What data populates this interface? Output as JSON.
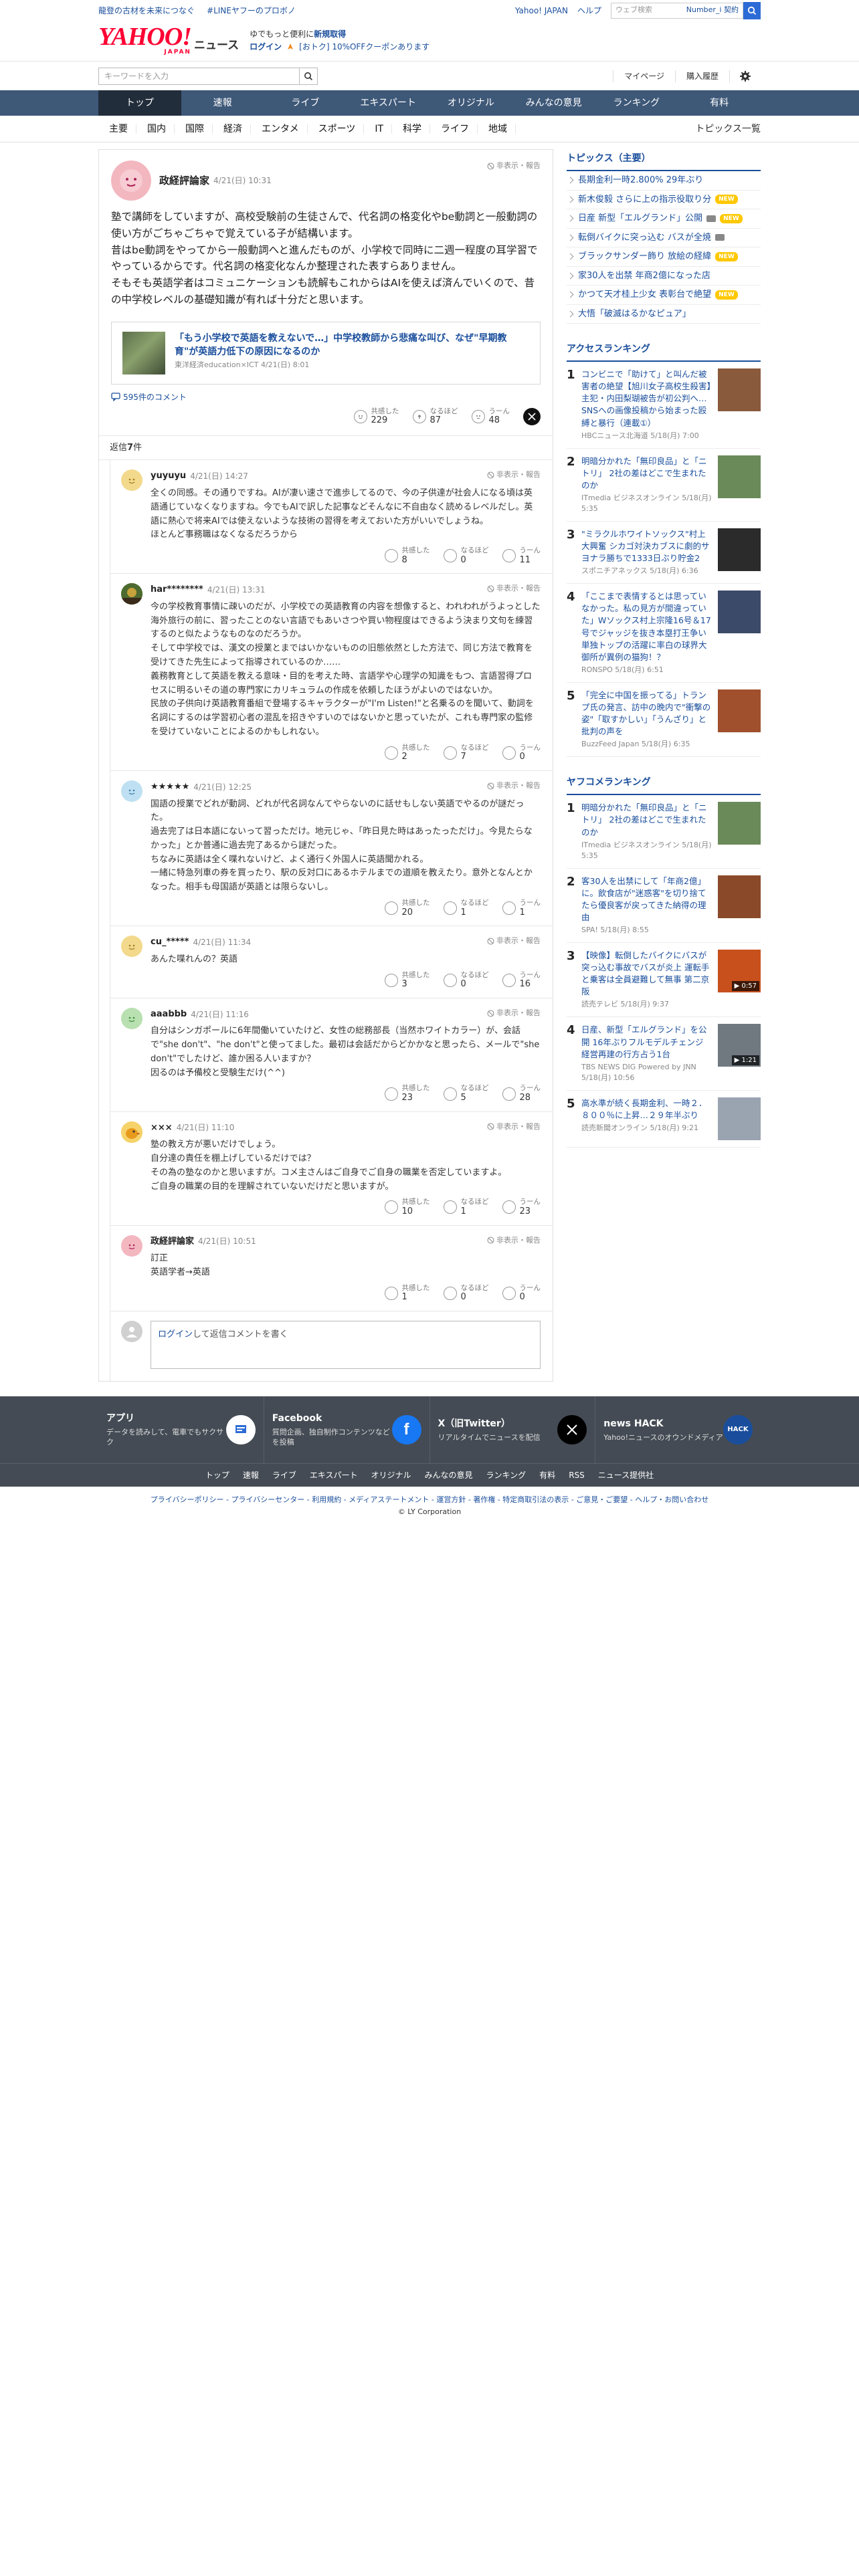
{
  "topstrip": {
    "link1": "龍登の古材を未来につなぐ",
    "link2": "#LINEヤフーのプロボノ",
    "yahoo": "Yahoo! JAPAN",
    "help": "ヘルプ",
    "web_placeholder": "ウェブ検索",
    "scope": "Number_i 契約"
  },
  "masthead": {
    "logo": "YAHOO!",
    "logo_sub": "JAPAN",
    "service": "ニュース",
    "promo_line1_a": "ゆでもっと便利に",
    "promo_line1_b": "新規取得",
    "login": "ログイン",
    "promo_line2": "[おトク] 10%OFFクーポンあります"
  },
  "searchbar": {
    "placeholder": "キーワードを入力",
    "mypage": "マイページ",
    "history": "購入履歴"
  },
  "mainnav": [
    "トップ",
    "速報",
    "ライブ",
    "エキスパート",
    "オリジナル",
    "みんなの意見",
    "ランキング",
    "有料"
  ],
  "subnav": [
    "主要",
    "国内",
    "国際",
    "経済",
    "エンタメ",
    "スポーツ",
    "IT",
    "科学",
    "ライフ",
    "地域"
  ],
  "subnav_more": "トピックス一覧",
  "original": {
    "user": "政経評論家",
    "time": "4/21(日) 10:31",
    "report": "非表示・報告",
    "text": "塾で講師をしていますが、高校受験前の生徒さんで、代名詞の格変化やbe動詞と一般動詞の使い方がごちゃごちゃで覚えている子が結構います。\n昔はbe動詞をやってから一般動詞へと進んだものが、小学校で同時に二週一程度の耳学習でやっているからです。代名詞の格変化なんか整理された表すらありません。\nそもそも英語学者はコミュニケーションも読解もこれからはAIを使えば済んでいくので、昔の中学校レベルの基礎知識が有れば十分だと思います。",
    "article_title": "「もう小学校で英語を教えないで…」中学校教師から悲痛な叫び、なぜ\"早期教育\"が英語力低下の原因になるのか",
    "article_source": "東洋経済education×ICT 4/21(日) 8:01",
    "comment_count": "595件のコメント",
    "labels": {
      "agree": "共感した",
      "hmm": "なるほど",
      "umm": "うーん"
    },
    "agree": "229",
    "hmm": "87",
    "umm": "48"
  },
  "reply_count_prefix": "返信",
  "reply_count": "7",
  "reply_count_suffix": "件",
  "replies": [
    {
      "user": "yuyuyu",
      "time": "4/21(日) 14:27",
      "report": "非表示・報告",
      "text": "全くの同感。その通りですね。AIが凄い速さで進歩してるので、今の子供達が社会人になる頃は英語通じていなくなりますね。今でもAIで訳した記事などそんなに不自由なく読めるレベルだし。英語に熱心で将来AIでは使えないような技術の習得を考えておいた方がいいでしょうね。\nほとんど事務職はなくなるだろうから",
      "agree": "8",
      "hmm": "0",
      "umm": "11"
    },
    {
      "user": "har********",
      "time": "4/21(日) 13:31",
      "report": "非表示・報告",
      "text": "今の学校教育事情に疎いのだが、小学校での英語教育の内容を想像すると、われわれがうよっとした海外旅行の前に、習ったことのない言語でもあいさつや買い物程度はできるよう決まり文句を練習するのと似たようなものなのだろうか。\nそして中学校では、漢文の授業とまではいかないものの旧態依然とした方法で、同じ方法で教育を受けてきた先生によって指導されているのか……\n義務教育として英語を教える意味・目的を考えた時、言語学や心理学の知識をもつ、言語習得プロセスに明るいその道の専門家にカリキュラムの作成を依頼したほうがよいのではないか。\n民放の子供向け英語教育番組で登場するキャラクターが\"I'm Listen!\"と名乗るのを聞いて、動詞を名詞にするのは学習初心者の混乱を招きやすいのではないかと思っていたが、これも専門家の監修を受けていないことによるのかもしれない。",
      "agree": "2",
      "hmm": "7",
      "umm": "0"
    },
    {
      "user": "★★★★★",
      "time": "4/21(日) 12:25",
      "report": "非表示・報告",
      "text": "国語の授業でどれが動詞、どれが代名詞なんてやらないのに話せもしない英語でやるのが謎だった。\n過去完了は日本語にないって習っただけ。地元じゃ、「昨日見た時はあったっただけ」。今見たらなかった」とか普通に過去完了あるから謎だった。\nちなみに英語は全く喋れないけど、よく通行く外国人に英語聞かれる。\n一緒に特急列車の券を買ったり、駅の反対口にあるホテルまでの道順を教えたり。意外となんとかなった。相手も母国語が英語とは限らないし。",
      "agree": "20",
      "hmm": "1",
      "umm": "1"
    },
    {
      "user": "cu_*****",
      "time": "4/21(日) 11:34",
      "report": "非表示・報告",
      "text": "あんた喋れんの？英語",
      "agree": "3",
      "hmm": "0",
      "umm": "16"
    },
    {
      "user": "aaabbb",
      "time": "4/21(日) 11:16",
      "report": "非表示・報告",
      "text": "自分はシンガポールに6年間働いていたけど、女性の総務部長（当然ホワイトカラー）が、会話で\"she don't\"、\"he don't\"と使ってました。最初は会話だからどかかなと思ったら、メールで\"she don't\"でしたけど、誰か困る人いますか？\n因るのは予備校と受験生だけ(^^)",
      "agree": "23",
      "hmm": "5",
      "umm": "28"
    },
    {
      "user": "×××",
      "time": "4/21(日) 11:10",
      "report": "非表示・報告",
      "text": "塾の教え方が悪いだけでしょう。\n自分達の責任を棚上げしているだけでは？\nその為の塾なのかと思いますが。コメ主さんはご自身でご自身の職業を否定していますよ。\nご自身の職業の目的を理解されていないだけだと思いますが。",
      "agree": "10",
      "hmm": "1",
      "umm": "23"
    },
    {
      "user": "政経評論家",
      "time": "4/21(日) 10:51",
      "report": "非表示・報告",
      "text": "訂正\n英語学者→英語",
      "agree": "1",
      "hmm": "0",
      "umm": "0"
    }
  ],
  "writebox": {
    "login": "ログイン",
    "rest": "して返信コメントを書く"
  },
  "side": {
    "topics_title": "トピックス（主要）",
    "topics": [
      {
        "text": "長期金利一時2.800% 29年ぶり",
        "badge": ""
      },
      {
        "text": "新木俊毅 さらに上の指示役取り分",
        "badge": "NEW"
      },
      {
        "text": "日産 新型「エルグランド」公開",
        "badge": "CAM NEW"
      },
      {
        "text": "転倒バイクに突っ込む バスが全焼",
        "badge": "CAM"
      },
      {
        "text": "ブラックサンダー飾り 放絵の経緯",
        "badge": "NEW"
      },
      {
        "text": "家30人を出禁 年商2億になった店",
        "badge": ""
      },
      {
        "text": "かつて天才桂上少女 表彰台で絶望",
        "badge": "NEW"
      },
      {
        "text": "大悟「破滅はるかなピュア」",
        "badge": ""
      }
    ],
    "access_title": "アクセスランキング",
    "access": [
      {
        "n": "1",
        "title": "コンビニで「助けて」と叫んだ被害者の絶望【旭川女子高校生殺害】主犯・内田梨瑚被告が初公判へ…SNSへの画像投稿から始まった殴縛と暴行（連載①）",
        "src": "HBCニュース北海道 5/18(月) 7:00",
        "img": "#8a5a3c",
        "vd": ""
      },
      {
        "n": "2",
        "title": "明暗分かれた「無印良品」と「ニトリ」 2社の差はどこで生まれたのか",
        "src": "ITmedia ビジネスオンライン 5/18(月) 5:35",
        "img": "#6a8a5a",
        "vd": ""
      },
      {
        "n": "3",
        "title": "\"ミラクルホワイトソックス\"村上大興奮 シカゴ対決カブスに劇的サヨナラ勝ちで1333日ぶり貯金2",
        "src": "スポニチアネックス 5/18(月) 6:36",
        "img": "#2b2b2b",
        "vd": ""
      },
      {
        "n": "4",
        "title": "「ここまで表情するとは思っていなかった。私の見方が間違っていた」Wソックス村上宗隆16号＆17号でジャッジを抜き本塁打王争い単独トップの活躍に率白の球界大御所が異例の猫狗！？",
        "src": "RONSPO 5/18(月) 6:51",
        "img": "#3c4a6a",
        "vd": ""
      },
      {
        "n": "5",
        "title": "「完全に中国を振ってる」トランプ氏の発言、訪中の晩内で\"衝撃の姿\"「取すかしい」「うんざり」と批判の声を",
        "src": "BuzzFeed Japan 5/18(月) 6:35",
        "img": "#a0502c",
        "vd": ""
      }
    ],
    "yafoo_title": "ヤフコメランキング",
    "yafoo": [
      {
        "n": "1",
        "title": "明暗分かれた「無印良品」と「ニトリ」 2社の差はどこで生まれたのか",
        "src": "ITmedia ビジネスオンライン 5/18(月) 5:35",
        "img": "#6a8a5a",
        "vd": ""
      },
      {
        "n": "2",
        "title": "客30人を出禁にして「年商2億」に。飲食店が\"迷惑客\"を切り捨てたら優良客が戻ってきた納得の理由",
        "src": "SPA! 5/18(月) 8:55",
        "img": "#8a4a2a",
        "vd": ""
      },
      {
        "n": "3",
        "title": "【映像】転倒したバイクにバスが突っ込む事故でバスが炎上 運転手と乗客は全員避難して無事 第二京阪",
        "src": "読売テレビ 5/18(月) 9:37",
        "img": "#c8501c",
        "vd": "▶ 0:57"
      },
      {
        "n": "4",
        "title": "日産、新型「エルグランド」を公開 16年ぶりフルモデルチェンジ 経営再建の行方占う1台",
        "src": "TBS NEWS DIG Powered by JNN 5/18(月) 10:56",
        "img": "#707880",
        "vd": "▶ 1:21"
      },
      {
        "n": "5",
        "title": "高水準が続く長期金利、一時２．８００％に上昇…２９年半ぶり",
        "src": "読売新聞オンライン 5/18(月) 9:21",
        "img": "#9aa4b0",
        "vd": ""
      }
    ]
  },
  "footer": {
    "cards": [
      {
        "name": "アプリ",
        "desc": "データを読みして、電車でもサクサク"
      },
      {
        "name": "Facebook",
        "desc": "質問企画、独自制作コンテンツなどを投稿"
      },
      {
        "name": "X（旧Twitter）",
        "desc": "リアルタイムでニュースを配信"
      },
      {
        "name": "news HACK",
        "desc": "Yahoo!ニュースのオウンドメディア"
      }
    ],
    "nav": [
      "トップ",
      "速報",
      "ライブ",
      "エキスパート",
      "オリジナル",
      "みんなの意見",
      "ランキング",
      "有料",
      "RSS",
      "ニュース提供社"
    ],
    "legal": "プライバシーポリシー - プライバシーセンター - 利用規約 - メディアステートメント - 運営方針 - 著作権 - 特定商取引法の表示 - ご意見・ご要望 - ヘルプ・お問い合わせ",
    "copy": "© LY Corporation"
  }
}
